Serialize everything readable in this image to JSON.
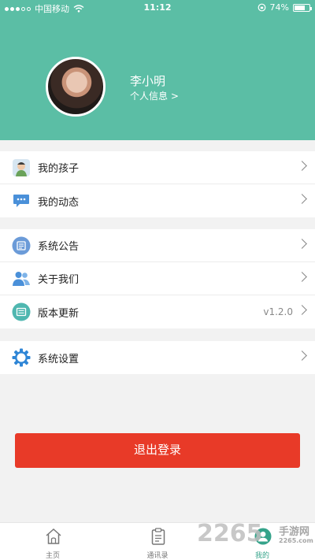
{
  "status_bar": {
    "carrier": "中国移动",
    "time": "11:12",
    "battery": "74%",
    "battery_level": 0.74
  },
  "profile": {
    "name": "李小明",
    "link": "个人信息 >"
  },
  "menu_groups": [
    [
      {
        "label": "我的孩子",
        "icon": "child-avatar-icon"
      },
      {
        "label": "我的动态",
        "icon": "chat-bubble-icon"
      }
    ],
    [
      {
        "label": "系统公告",
        "icon": "notice-board-icon"
      },
      {
        "label": "关于我们",
        "icon": "people-icon"
      },
      {
        "label": "版本更新",
        "icon": "update-list-icon",
        "value": "v1.2.0"
      }
    ],
    [
      {
        "label": "系统设置",
        "icon": "gear-icon"
      }
    ]
  ],
  "logout_label": "退出登录",
  "tabbar": [
    {
      "label": "主页",
      "icon": "home-icon"
    },
    {
      "label": "通讯录",
      "icon": "clipboard-icon"
    },
    {
      "label": "我的",
      "icon": "user-icon",
      "active": true
    }
  ],
  "watermark": {
    "number": "2265",
    "name_cn": "手游网",
    "site": "2265.com"
  },
  "colors": {
    "header": "#5bbea5",
    "logout": "#e83a28",
    "active_tab": "#35a38a"
  }
}
